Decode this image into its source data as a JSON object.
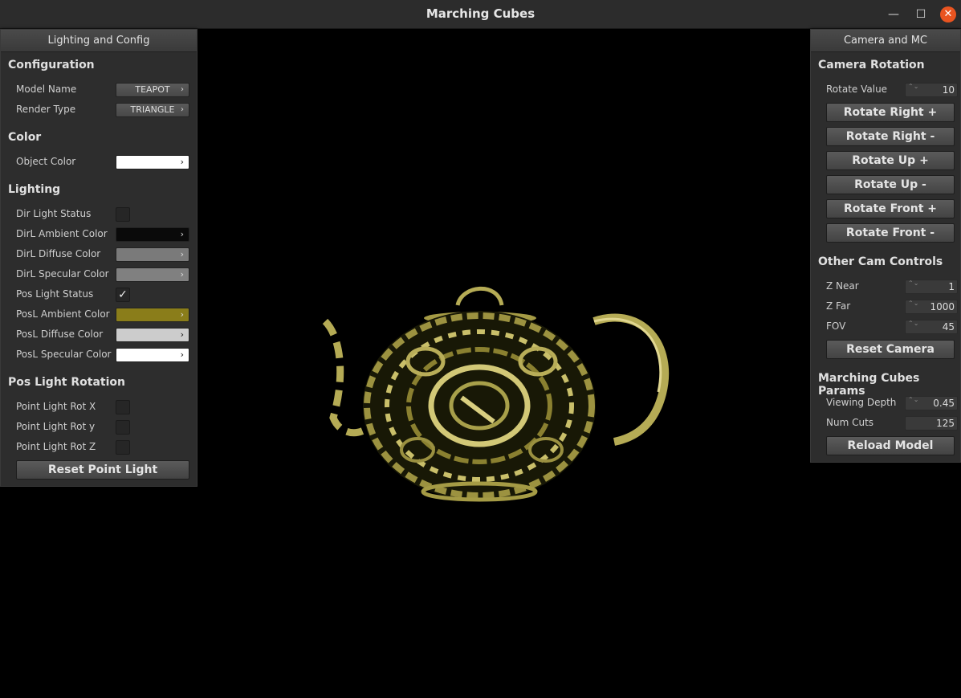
{
  "window": {
    "title": "Marching Cubes",
    "minimize": "—",
    "maximize": "☐",
    "close": "✕"
  },
  "left_panel": {
    "header": "Lighting and Config",
    "configuration": {
      "title": "Configuration",
      "model_name_label": "Model Name",
      "model_name_value": "TEAPOT",
      "render_type_label": "Render Type",
      "render_type_value": "TRIANGLE"
    },
    "color": {
      "title": "Color",
      "object_color_label": "Object Color",
      "object_color": "#ffffff"
    },
    "lighting": {
      "title": "Lighting",
      "dir_light_status_label": "Dir Light Status",
      "dir_light_status": false,
      "dirl_ambient_label": "DirL Ambient Color",
      "dirl_ambient": "#0a0a0a",
      "dirl_diffuse_label": "DirL Diffuse Color",
      "dirl_diffuse": "#7a7a7a",
      "dirl_specular_label": "DirL Specular Color",
      "dirl_specular": "#808080",
      "pos_light_status_label": "Pos Light Status",
      "pos_light_status": true,
      "posl_ambient_label": "PosL Ambient Color",
      "posl_ambient": "#8a7d1a",
      "posl_diffuse_label": "PosL Diffuse Color",
      "posl_diffuse": "#cccccc",
      "posl_specular_label": "PosL Specular Color",
      "posl_specular": "#ffffff"
    },
    "pos_light_rotation": {
      "title": "Pos Light Rotation",
      "rot_x_label": "Point Light Rot X",
      "rot_y_label": "Point Light Rot y",
      "rot_z_label": "Point Light Rot Z",
      "reset_label": "Reset Point Light"
    }
  },
  "right_panel": {
    "header": "Camera and MC",
    "camera_rotation": {
      "title": "Camera Rotation",
      "rotate_value_label": "Rotate Value",
      "rotate_value": "10",
      "buttons": [
        "Rotate Right +",
        "Rotate Right -",
        "Rotate Up +",
        "Rotate Up -",
        "Rotate Front +",
        "Rotate Front -"
      ]
    },
    "other_cam": {
      "title": "Other Cam Controls",
      "z_near_label": "Z Near",
      "z_near": "1",
      "z_far_label": "Z Far",
      "z_far": "1000",
      "fov_label": "FOV",
      "fov": "45",
      "reset_label": "Reset Camera"
    },
    "mc_params": {
      "title": "Marching Cubes Params",
      "viewing_depth_label": "Viewing Depth",
      "viewing_depth": "0.45",
      "num_cuts_label": "Num Cuts",
      "num_cuts": "125",
      "reload_label": "Reload Model"
    }
  },
  "icons": {
    "chevron": "›",
    "spin_arrows": "⌃⌄",
    "check": "✓"
  },
  "colors": {
    "teapot": "#c9bf6a",
    "teapot_shadow": "#6e6526"
  }
}
